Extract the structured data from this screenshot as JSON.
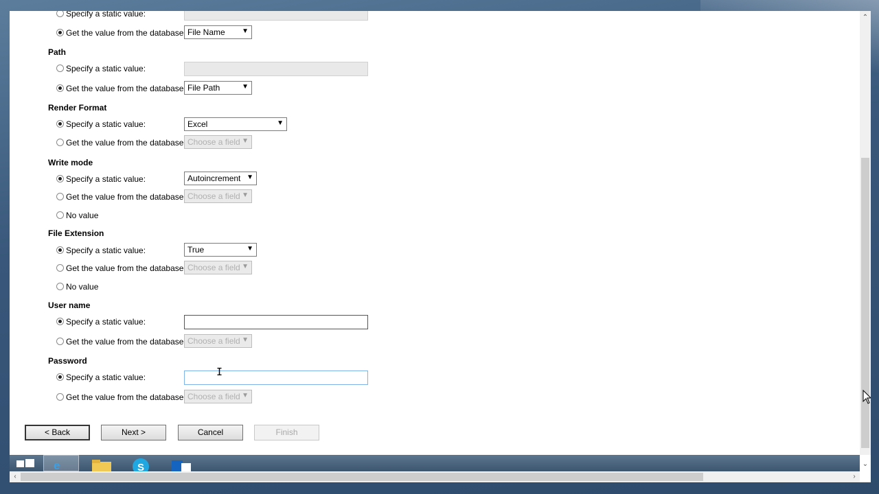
{
  "sections": [
    {
      "title": null,
      "options": [
        {
          "label": "Specify a static value:",
          "checked": false
        },
        {
          "label": "Get the value from the database:",
          "checked": true
        }
      ],
      "database_select": {
        "value": "File Name",
        "disabled": false
      }
    },
    {
      "title": "Path",
      "options": [
        {
          "label": "Specify a static value:",
          "checked": false
        },
        {
          "label": "Get the value from the database:",
          "checked": true
        }
      ],
      "database_select": {
        "value": "File Path",
        "disabled": false
      }
    },
    {
      "title": "Render Format",
      "options": [
        {
          "label": "Specify a static value:",
          "checked": true
        },
        {
          "label": "Get the value from the database:",
          "checked": false
        }
      ],
      "static_select": {
        "value": "Excel"
      },
      "database_select": {
        "value": "Choose a field",
        "disabled": true
      }
    },
    {
      "title": "Write mode",
      "options": [
        {
          "label": "Specify a static value:",
          "checked": true
        },
        {
          "label": "Get the value from the database:",
          "checked": false
        },
        {
          "label": "No value",
          "checked": false
        }
      ],
      "static_select": {
        "value": "Autoincrement"
      },
      "database_select": {
        "value": "Choose a field",
        "disabled": true
      }
    },
    {
      "title": "File Extension",
      "options": [
        {
          "label": "Specify a static value:",
          "checked": true
        },
        {
          "label": "Get the value from the database:",
          "checked": false
        },
        {
          "label": "No value",
          "checked": false
        }
      ],
      "static_select": {
        "value": "True"
      },
      "database_select": {
        "value": "Choose a field",
        "disabled": true
      }
    },
    {
      "title": "User name",
      "options": [
        {
          "label": "Specify a static value:",
          "checked": true
        },
        {
          "label": "Get the value from the database:",
          "checked": false
        }
      ],
      "static_input": {
        "value": ""
      },
      "database_select": {
        "value": "Choose a field",
        "disabled": true
      }
    },
    {
      "title": "Password",
      "options": [
        {
          "label": "Specify a static value:",
          "checked": true
        },
        {
          "label": "Get the value from the database:",
          "checked": false
        }
      ],
      "static_input": {
        "value": ""
      },
      "database_select": {
        "value": "Choose a field",
        "disabled": true
      }
    }
  ],
  "buttons": {
    "back": "< Back",
    "next": "Next >",
    "cancel": "Cancel",
    "finish": "Finish"
  },
  "taskbar": {
    "items": [
      "windows-start-icon",
      "internet-explorer-icon",
      "file-explorer-icon",
      "skype-icon",
      "outlook-icon"
    ],
    "active": "internet-explorer-icon"
  },
  "colors": {
    "desktop": "#3f5f7f",
    "page_background": "#ffffff",
    "disabled_text": "#b0b0b0",
    "focus_border": "#7eb4ea"
  }
}
